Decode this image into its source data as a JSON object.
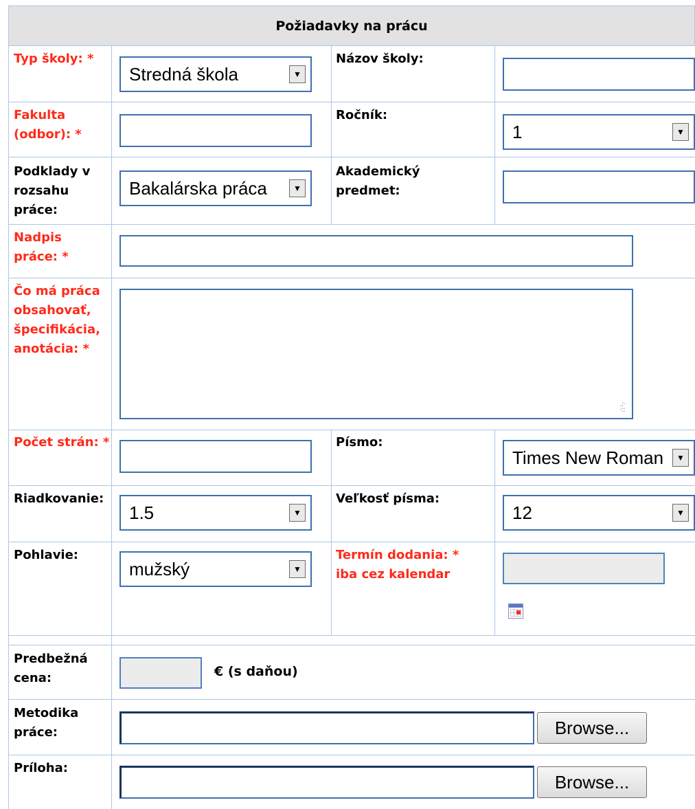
{
  "form": {
    "title": "Požiadavky na prácu",
    "required_color": "#ff2a1a",
    "border_color": "#aac6e6",
    "rows": {
      "school_type": {
        "label": "Typ školy: *",
        "value": "Stredná škola"
      },
      "school_name": {
        "label": "Názov školy:",
        "value": ""
      },
      "faculty": {
        "label": "Fakulta (odbor): *",
        "value": ""
      },
      "year": {
        "label": "Ročník:",
        "value": "1"
      },
      "materials": {
        "label": "Podklady v rozsahu práce:",
        "value": "Bakalárska práca"
      },
      "subject": {
        "label": "Akademický predmet:",
        "value": ""
      },
      "work_title": {
        "label": "Nadpis práce: *",
        "value": ""
      },
      "content": {
        "label": "Čo má práca obsahovať, špecifikácia, anotácia: *",
        "value": ""
      },
      "page_count": {
        "label": "Počet strán: *",
        "value": ""
      },
      "font": {
        "label": "Písmo:",
        "value": "Times New Roman"
      },
      "line_spacing": {
        "label": "Riadkovanie:",
        "value": "1.5"
      },
      "font_size": {
        "label": "Veľkosť písma:",
        "value": "12"
      },
      "gender": {
        "label": "Pohlavie:",
        "value": "mužský"
      },
      "deadline": {
        "label": "Termín dodania: * iba cez kalendar",
        "value": ""
      },
      "price": {
        "label": "Predbežná cena:",
        "value": "",
        "unit": "€ (s daňou)"
      },
      "methodology": {
        "label": "Metodika práce:",
        "button": "Browse..."
      },
      "attachment": {
        "label": "Príloha:",
        "button": "Browse..."
      }
    },
    "icons": {
      "calendar": "calendar-icon",
      "select_arrow": "chevron-down-icon"
    }
  }
}
